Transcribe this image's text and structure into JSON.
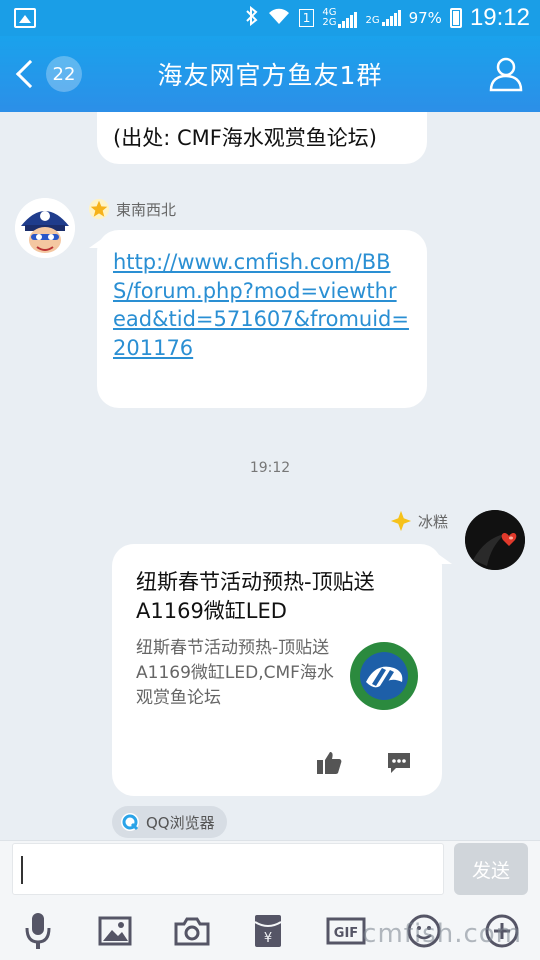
{
  "status_bar": {
    "sim_indicator": "1",
    "network_top": "4G",
    "network_bottom": "2G",
    "network_secondary": "2G",
    "battery_percent": "97%",
    "time": "19:12"
  },
  "header": {
    "back_badge": "22",
    "title": "海友网官方鱼友1群"
  },
  "messages": {
    "partial_bubble_text": "(出处: CMF海水观赏鱼论坛)",
    "first": {
      "sender": "東南西北",
      "link": "http://www.cmfish.com/BBS/forum.php?mod=viewthread&tid=571607&fromuid=201176"
    },
    "timestamp": "19:12",
    "second": {
      "sender": "冰糕",
      "card_title": "纽斯春节活动预热-顶贴送A1169微缸LED",
      "card_description": "纽斯春节活动预热-顶贴送A1169微缸LED,CMF海水观赏鱼论坛",
      "source": "QQ浏览器"
    }
  },
  "input_bar": {
    "send_label": "发送"
  },
  "toolbar": {
    "icons": [
      "microphone-icon",
      "image-icon",
      "camera-icon",
      "red-packet-icon",
      "gif-icon",
      "emoji-icon",
      "plus-icon"
    ]
  },
  "watermark": "cmfish.com",
  "colors": {
    "header_blue": "#1a9ee7",
    "link_blue": "#2a8fd3",
    "chat_background": "#e9eef3"
  }
}
